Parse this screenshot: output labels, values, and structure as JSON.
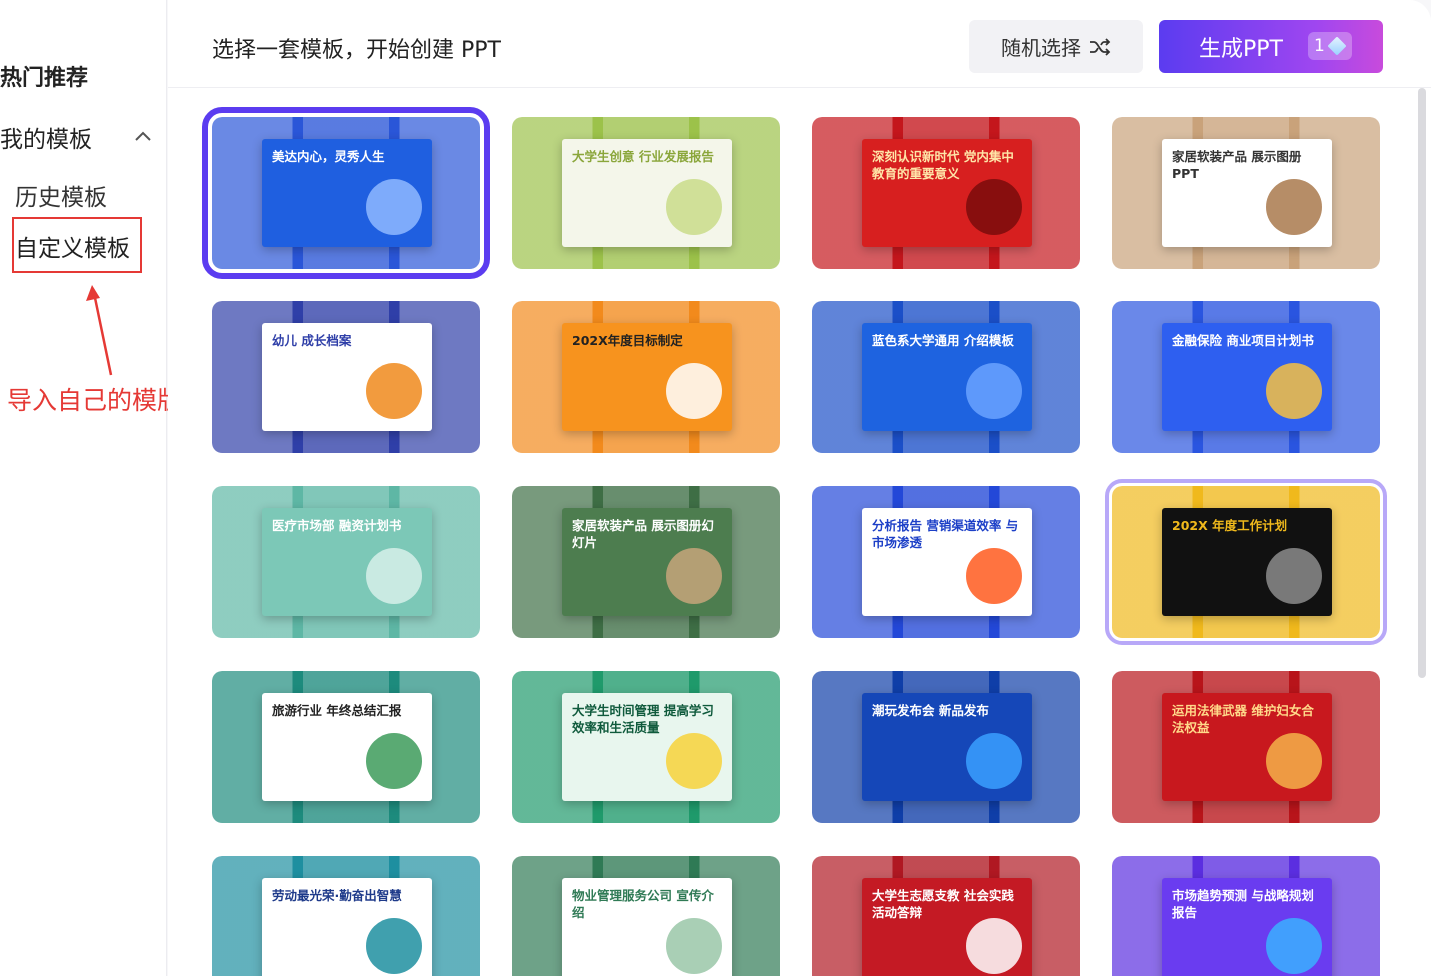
{
  "sidebar": {
    "section_title": "热门推荐",
    "my_templates": "我的模板",
    "history": "历史模板",
    "custom": "自定义模板",
    "annotation": "导入自己的模版"
  },
  "header": {
    "title": "选择一套模板，开始创建 PPT",
    "random_label": "随机选择",
    "generate_label": "生成PPT",
    "generate_badge": "1"
  },
  "colors": {
    "primary": "#5b3cf0",
    "annotation_red": "#e53935"
  },
  "templates": [
    {
      "title": "美达内心，灵秀人生",
      "bg": "#2a56d8",
      "panel": "#1f5fe0",
      "fg": "#ffffff",
      "accent": "#8fb8ff",
      "selected": "blue"
    },
    {
      "title": "大学生创意 行业发展报告",
      "bg": "#9cc24a",
      "panel": "#f4f6ea",
      "fg": "#8aa63a",
      "accent": "#c9dc8a",
      "selected": ""
    },
    {
      "title": "深刻认识新时代 党内集中教育的重要意义",
      "bg": "#c4161c",
      "panel": "#d71f1f",
      "fg": "#ffe5a8",
      "accent": "#7a0c0c",
      "selected": ""
    },
    {
      "title": "家居软装产品 展示图册PPT",
      "bg": "#c9a27a",
      "panel": "#ffffff",
      "fg": "#333333",
      "accent": "#a9794c",
      "selected": ""
    },
    {
      "title": "幼儿 成长档案",
      "bg": "#2f3fa8",
      "panel": "#ffffff",
      "fg": "#2f3fa8",
      "accent": "#f08a1c",
      "selected": ""
    },
    {
      "title": "202X年度目标制定",
      "bg": "#f28a1c",
      "panel": "#f7931e",
      "fg": "#222222",
      "accent": "#ffffff",
      "selected": ""
    },
    {
      "title": "蓝色系大学通用 介绍模板",
      "bg": "#1b4fc8",
      "panel": "#1e63e0",
      "fg": "#ffffff",
      "accent": "#6aa2ff",
      "selected": ""
    },
    {
      "title": "金融保险 商业项目计划书",
      "bg": "#2a55e0",
      "panel": "#2e5ff0",
      "fg": "#ffffff",
      "accent": "#f6c142",
      "selected": ""
    },
    {
      "title": "医疗市场部 融资计划书",
      "bg": "#5eb7a5",
      "panel": "#7cc8b7",
      "fg": "#ffffff",
      "accent": "#d7f0ea",
      "selected": ""
    },
    {
      "title": "家居软装产品 展示图册幻灯片",
      "bg": "#3e6e45",
      "panel": "#4d7d4f",
      "fg": "#ffffff",
      "accent": "#c7a57a",
      "selected": ""
    },
    {
      "title": "分析报告 营销渠道效率 与市场渗透",
      "bg": "#2348d8",
      "panel": "#ffffff",
      "fg": "#1c3fc7",
      "accent": "#ff5a1f",
      "selected": ""
    },
    {
      "title": "202X 年度工作计划",
      "bg": "#f0b91c",
      "panel": "#111111",
      "fg": "#f0b91c",
      "accent": "#8c8c8c",
      "selected": "purple"
    },
    {
      "title": "旅游行业 年终总结汇报",
      "bg": "#1d8b7d",
      "panel": "#ffffff",
      "fg": "#222222",
      "accent": "#3d9b5a",
      "selected": ""
    },
    {
      "title": "大学生时间管理 提高学习效率和生活质量",
      "bg": "#1f9a6b",
      "panel": "#e8f6ee",
      "fg": "#0f5a3c",
      "accent": "#f7d23a",
      "selected": ""
    },
    {
      "title": "潮玩发布会 新品发布",
      "bg": "#0f3ea8",
      "panel": "#1547b8",
      "fg": "#ffffff",
      "accent": "#3aa0ff",
      "selected": ""
    },
    {
      "title": "运用法律武器 维护妇女合法权益",
      "bg": "#b8141a",
      "panel": "#c8181e",
      "fg": "#ffd98a",
      "accent": "#f4b24a",
      "selected": ""
    },
    {
      "title": "劳动最光荣·勤奋出智慧",
      "bg": "#1e8fa0",
      "panel": "#ffffff",
      "fg": "#1e3a8a",
      "accent": "#1e8fa0",
      "selected": ""
    },
    {
      "title": "物业管理服务公司 宣传介绍",
      "bg": "#2f7a55",
      "panel": "#ffffff",
      "fg": "#2f7a55",
      "accent": "#9ac7a8",
      "selected": ""
    },
    {
      "title": "大学生志愿支教 社会实践活动答辩",
      "bg": "#b01822",
      "panel": "#c41a24",
      "fg": "#ffffff",
      "accent": "#ffffff",
      "selected": ""
    },
    {
      "title": "市场趋势预测 与战略规划报告",
      "bg": "#5b2ee0",
      "panel": "#6a3cf0",
      "fg": "#ffffff",
      "accent": "#3ab0ff",
      "selected": ""
    }
  ]
}
